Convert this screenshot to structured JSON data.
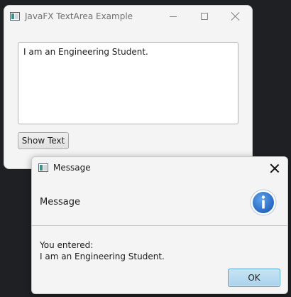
{
  "main_window": {
    "title": "JavaFX TextArea Example",
    "textarea_value": "I am an Engineering Student.",
    "show_button_label": "Show Text"
  },
  "dialog": {
    "title": "Message",
    "header_text": "Message",
    "content_line1": "You entered:",
    "content_line2": "I am an Engineering Student.",
    "ok_label": "OK",
    "icon": "info-icon",
    "accent_color": "#3b7fd0"
  }
}
